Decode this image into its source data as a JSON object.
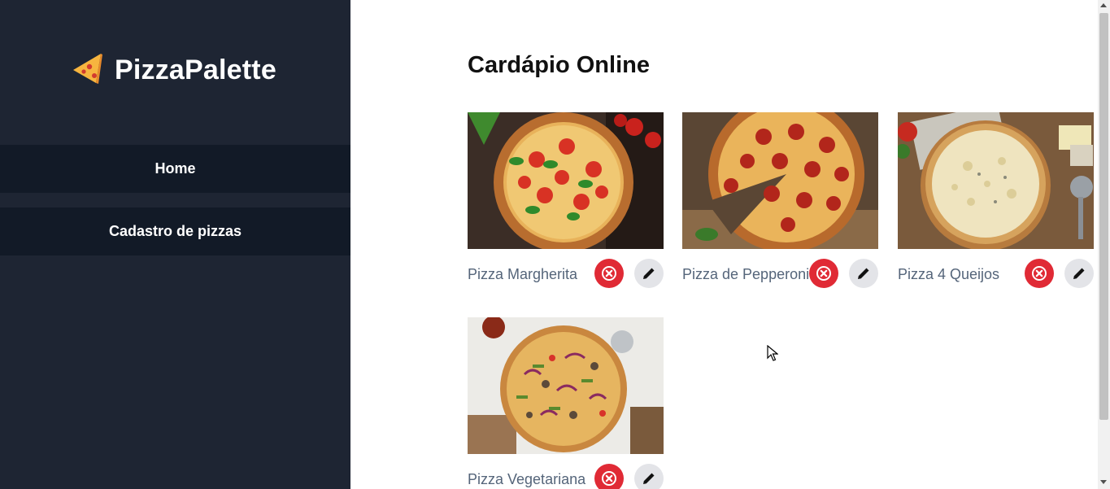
{
  "brand": {
    "name": "PizzaPalette",
    "icon": "pizza-slice-icon"
  },
  "sidebar": {
    "items": [
      {
        "label": "Home"
      },
      {
        "label": "Cadastro de pizzas"
      }
    ]
  },
  "main": {
    "title": "Cardápio Online",
    "pizzas": [
      {
        "name": "Pizza Margherita"
      },
      {
        "name": "Pizza de Pepperoni"
      },
      {
        "name": "Pizza 4 Queijos"
      },
      {
        "name": "Pizza Vegetariana"
      }
    ]
  },
  "colors": {
    "sidebar_bg": "#1e2533",
    "nav_item_bg": "#121a27",
    "delete_button": "#e02a35",
    "edit_button": "#e3e4e8",
    "pizza_name_text": "#55657a"
  },
  "icons": {
    "delete": "x-circle-icon",
    "edit": "pencil-icon"
  }
}
